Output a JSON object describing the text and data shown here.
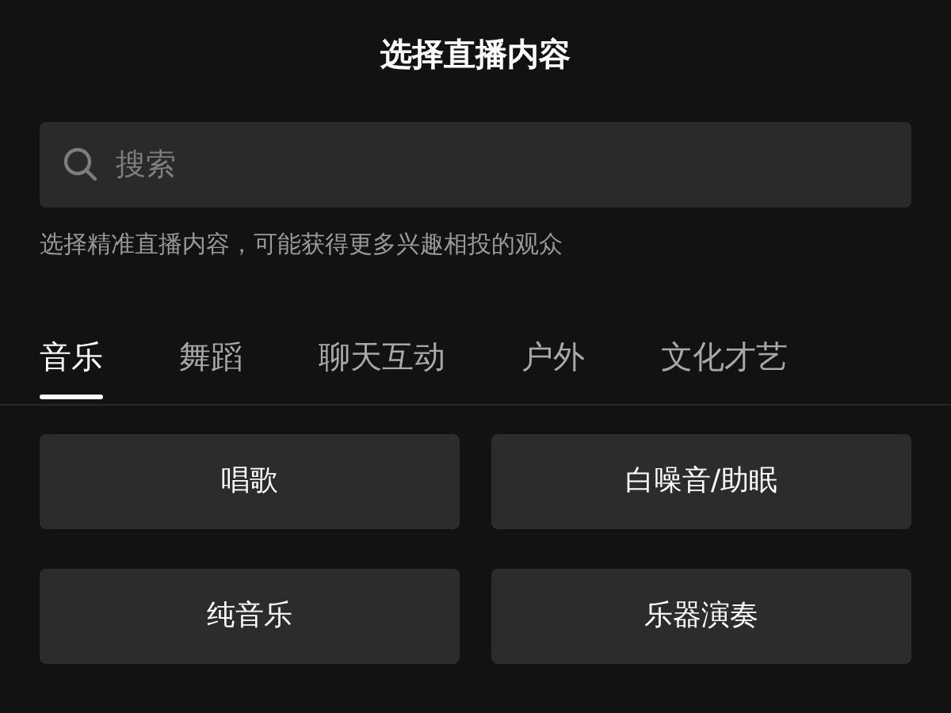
{
  "header": {
    "title": "选择直播内容"
  },
  "search": {
    "placeholder": "搜索"
  },
  "hint": "选择精准直播内容，可能获得更多兴趣相投的观众",
  "tabs": [
    {
      "label": "音乐",
      "selected": true
    },
    {
      "label": "舞蹈",
      "selected": false
    },
    {
      "label": "聊天互动",
      "selected": false
    },
    {
      "label": "户外",
      "selected": false
    },
    {
      "label": "文化才艺",
      "selected": false
    }
  ],
  "options": [
    "唱歌",
    "白噪音/助眠",
    "纯音乐",
    "乐器演奏"
  ]
}
